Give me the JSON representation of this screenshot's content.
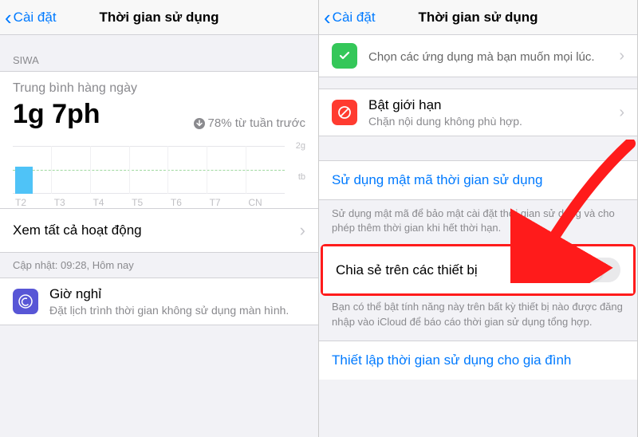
{
  "nav": {
    "back": "Cài đặt",
    "title": "Thời gian sử dụng"
  },
  "left": {
    "section_header": "SIWA",
    "avg_label": "Trung bình hàng ngày",
    "avg_value": "1g 7ph",
    "avg_change": "78% từ tuần trước",
    "y_top": "2g",
    "y_mid": "tb",
    "days": [
      "T2",
      "T3",
      "T4",
      "T5",
      "T6",
      "T7",
      "CN"
    ],
    "see_all": "Xem tất cả hoạt động",
    "updated": "Cập nhật: 09:28, Hôm nay",
    "downtime_title": "Giờ nghỉ",
    "downtime_sub": "Đặt lịch trình thời gian không sử dụng màn hình."
  },
  "right": {
    "always_allowed_sub": "Chọn các ứng dụng mà bạn muốn mọi lúc.",
    "limits_title": "Bật giới hạn",
    "limits_sub": "Chặn nội dung không phù hợp.",
    "passcode_title": "Sử dụng mật mã thời gian sử dụng",
    "passcode_desc": "Sử dụng mật mã để bảo mật cài đặt thời gian sử dụng và cho phép thêm thời gian khi hết thời hạn.",
    "share_title": "Chia sẻ trên các thiết bị",
    "share_desc": "Bạn có thể bật tính năng này trên bất kỳ thiết bị nào được đăng nhập vào iCloud để báo cáo thời gian sử dụng tổng hợp.",
    "family_title": "Thiết lập thời gian sử dụng cho gia đình"
  },
  "chart_data": {
    "type": "bar",
    "categories": [
      "T2",
      "T3",
      "T4",
      "T5",
      "T6",
      "T7",
      "CN"
    ],
    "values": [
      1.12,
      0,
      0,
      0,
      0,
      0,
      0
    ],
    "title": "Trung bình hàng ngày",
    "ylabel": "giờ",
    "ylim": [
      0,
      2
    ],
    "average_line_label": "tb",
    "average_change_pct": -78
  }
}
